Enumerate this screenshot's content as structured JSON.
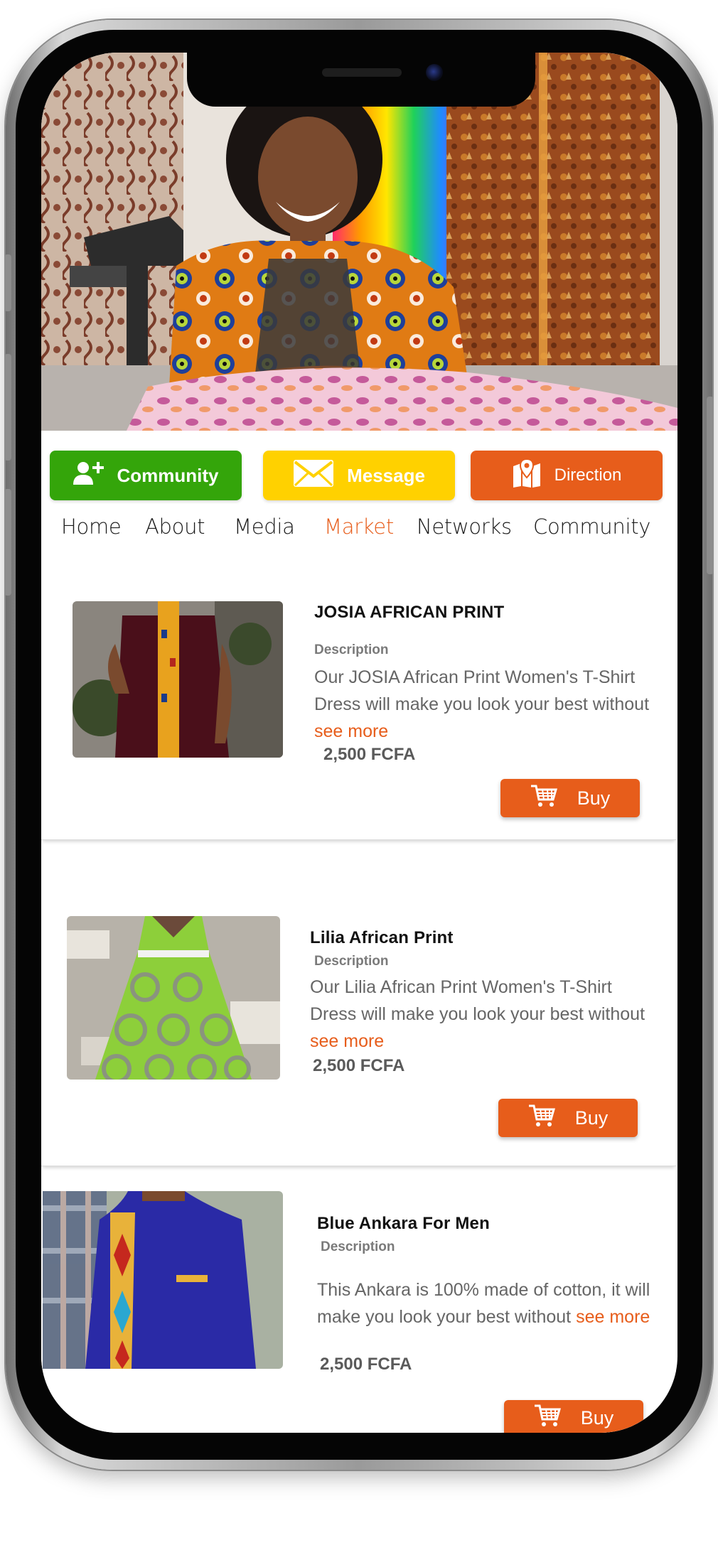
{
  "actions": {
    "community_label": "Community",
    "message_label": "Message",
    "direction_label": "Direction"
  },
  "nav": {
    "items": [
      "Home",
      "About",
      "Media",
      "Market",
      "Networks",
      "Community"
    ],
    "active": "Market"
  },
  "products": [
    {
      "title": "JOSIA AFRICAN PRINT",
      "description_label": "Description",
      "description": "Our JOSIA African Print Women's T-Shirt Dress will make you look your best without",
      "see_more": "see more",
      "price": "2,500 FCFA",
      "buy_label": "Buy"
    },
    {
      "title": "Lilia African Print",
      "description_label": "Description",
      "description": "Our Lilia African Print Women's T-Shirt Dress will make you look your best without",
      "see_more": "see more",
      "price": "2,500 FCFA",
      "buy_label": "Buy"
    },
    {
      "title": "Blue Ankara For Men",
      "description_label": "Description",
      "description": "This Ankara is 100% made of cotton, it will make you look your best without",
      "see_more": "see more",
      "price": "2,500 FCFA",
      "buy_label": "Buy"
    }
  ],
  "colors": {
    "accent": "#e75d1b",
    "community": "#34a50a",
    "message": "#ffd100"
  },
  "icons": {
    "community": "add-user-icon",
    "message": "envelope-icon",
    "direction": "map-pin-icon",
    "buy": "shopping-cart-icon"
  }
}
